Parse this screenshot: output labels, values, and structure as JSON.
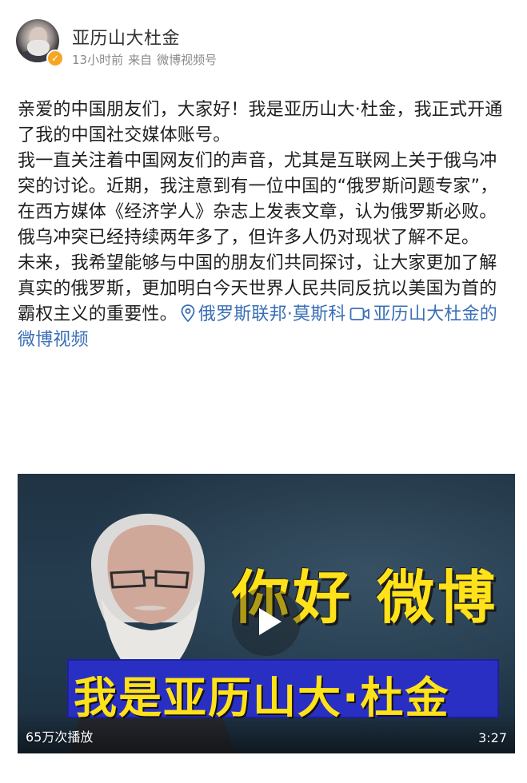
{
  "post": {
    "author": "亚历山大杜金",
    "time": "13小时前",
    "source_prefix": "来自",
    "source": "微博视频号",
    "paragraphs": [
      "亲爱的中国朋友们，大家好！我是亚历山大·杜金，我正式开通了我的中国社交媒体账号。",
      "我一直关注着中国网友们的声音，尤其是互联网上关于俄乌冲突的讨论。近期，我注意到有一位中国的“俄罗斯问题专家”，在西方媒体《经济学人》杂志上发表文章，认为俄罗斯必败。俄乌冲突已经持续两年多了，但许多人仍对现状了解不足。",
      "未来，我希望能够与中国的朋友们共同探讨，让大家更加了解真实的俄罗斯，更加明白今天世界人民共同反抗以美国为首的霸权主义的重要性。"
    ],
    "location": "俄罗斯联邦·莫斯科",
    "video_link": "亚历山大杜金的微博视频"
  },
  "video": {
    "headline": "你好 微博",
    "banner": "我是亚历山大·杜金",
    "play_count": "65万次播放",
    "duration": "3:27"
  },
  "colors": {
    "link": "#3a6fb7",
    "headline_yellow": "#ffe21a",
    "banner_blue": "#2a2fc4",
    "verified": "#f5a623"
  },
  "icons": {
    "verified": "verified-badge-icon",
    "location": "location-pin-icon",
    "video": "video-camera-icon",
    "play": "play-icon"
  }
}
